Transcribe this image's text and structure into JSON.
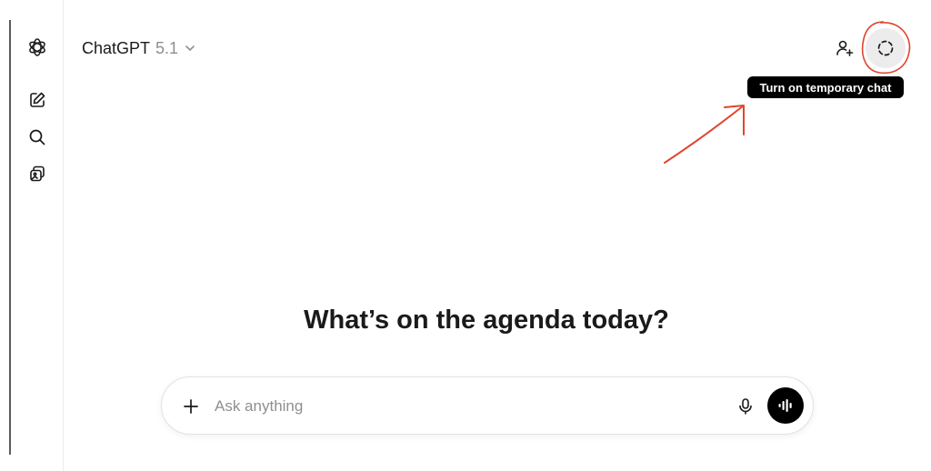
{
  "sidebar": {
    "items": [
      {
        "icon": "openai-logo-icon"
      },
      {
        "icon": "new-chat-icon"
      },
      {
        "icon": "search-icon"
      },
      {
        "icon": "library-icon"
      }
    ]
  },
  "header": {
    "model_name": "ChatGPT",
    "model_version": "5.1",
    "model_chevron": "chevron-down-icon",
    "share_icon": "add-person-icon",
    "temporary_chat_icon": "dashed-circle-icon",
    "tooltip": "Turn on temporary chat"
  },
  "main": {
    "headline": "What’s on the agenda today?"
  },
  "composer": {
    "placeholder": "Ask anything",
    "value": "",
    "plus_icon": "plus-icon",
    "mic_icon": "microphone-icon",
    "voice_icon": "voice-mode-icon"
  },
  "colors": {
    "annotation": "#e0452f",
    "tooltip_bg": "#000000",
    "temp_button_bg": "#ececec"
  }
}
